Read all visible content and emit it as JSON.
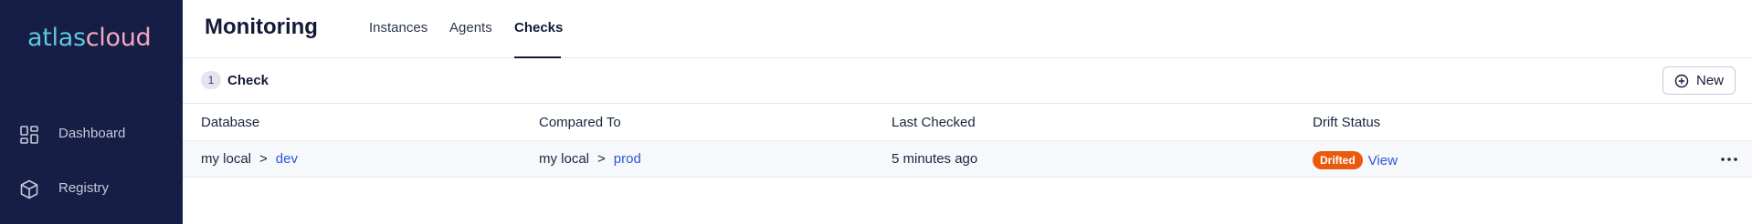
{
  "sidebar": {
    "logo": {
      "part1": "atlas",
      "part2": "cloud"
    },
    "items": [
      {
        "label": "Dashboard",
        "icon": "dashboard-grid-icon"
      },
      {
        "label": "Registry",
        "icon": "cube-icon"
      }
    ]
  },
  "header": {
    "title": "Monitoring",
    "tabs": [
      {
        "label": "Instances",
        "active": false
      },
      {
        "label": "Agents",
        "active": false
      },
      {
        "label": "Checks",
        "active": true
      }
    ]
  },
  "toolbar": {
    "count": "1",
    "count_label": "Check",
    "new_button": {
      "label": "New",
      "icon": "plus-circle-icon"
    }
  },
  "table": {
    "columns": [
      "Database",
      "Compared To",
      "Last Checked",
      "Drift Status"
    ],
    "rows": [
      {
        "database": {
          "source": "my local",
          "separator": ">",
          "target": "dev"
        },
        "compared_to": {
          "source": "my local",
          "separator": ">",
          "target": "prod"
        },
        "last_checked": "5 minutes ago",
        "drift_status": "Drifted",
        "view_label": "View"
      }
    ]
  },
  "colors": {
    "sidebar_bg": "#161e46",
    "logo_atlas": "#5ec6dd",
    "logo_cloud": "#f0a9bd",
    "link": "#2b57d6",
    "drift_badge": "#ea5a0c"
  }
}
